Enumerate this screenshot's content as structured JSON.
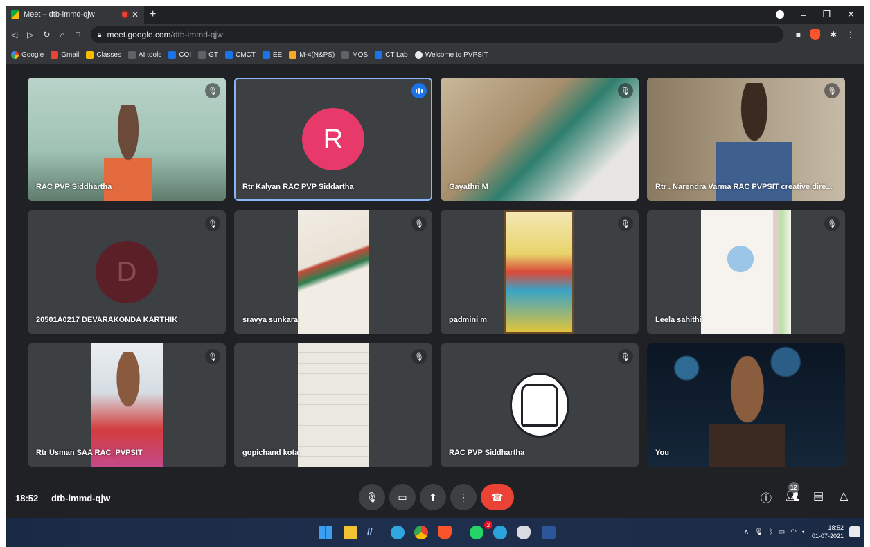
{
  "browser": {
    "tab_title": "Meet – dtb-immd-qjw",
    "url_host": "meet.google.com",
    "url_path": "/dtb-immd-qjw",
    "bookmarks": [
      {
        "label": "Google",
        "icon": "google-icon"
      },
      {
        "label": "Gmail",
        "icon": "gmail-icon"
      },
      {
        "label": "Classes",
        "icon": "classroom-icon"
      },
      {
        "label": "AI tools",
        "icon": "folder-icon"
      },
      {
        "label": "COI",
        "icon": "classroom-icon"
      },
      {
        "label": "GT",
        "icon": "folder-icon"
      },
      {
        "label": "CMCT",
        "icon": "classroom-icon"
      },
      {
        "label": "EE",
        "icon": "classroom-icon"
      },
      {
        "label": "M-4(N&PS)",
        "icon": "classroom-icon"
      },
      {
        "label": "MOS",
        "icon": "folder-icon"
      },
      {
        "label": "CT Lab",
        "icon": "classroom-icon"
      },
      {
        "label": "Welcome to PVPSIT",
        "icon": "globe-icon"
      }
    ]
  },
  "participants": [
    {
      "name": "RAC PVP Siddhartha",
      "state": "video",
      "muted": true
    },
    {
      "name": "Rtr Kalyan RAC PVP Siddartha",
      "state": "avatar",
      "initial": "R",
      "avatar_color": "#e8396b",
      "speaking": true
    },
    {
      "name": "Gayathri M",
      "state": "video",
      "muted": true
    },
    {
      "name": "Rtr . Narendra Varma RAC PVPSIT creative dire...",
      "state": "video",
      "muted": true
    },
    {
      "name": "20501A0217 DEVARAKONDA KARTHIK",
      "state": "avatar",
      "initial": "D",
      "avatar_color": "#6d1a22",
      "muted": true
    },
    {
      "name": "sravya sunkara",
      "state": "video",
      "muted": true
    },
    {
      "name": "padmini m",
      "state": "video",
      "muted": true
    },
    {
      "name": "Leela sahithi",
      "state": "video",
      "muted": true
    },
    {
      "name": "Rtr Usman SAA RAC_PVPSIT",
      "state": "video",
      "muted": true
    },
    {
      "name": "gopichand kota",
      "state": "video",
      "muted": true
    },
    {
      "name": "RAC PVP Siddhartha",
      "state": "video",
      "muted": true
    },
    {
      "name": "You",
      "state": "video",
      "muted": false
    }
  ],
  "controls": {
    "time": "18:52",
    "meeting_code": "dtb-immd-qjw",
    "people_count": "12"
  },
  "taskbar": {
    "clock_time": "18:52",
    "clock_date": "01-07-2021",
    "whatsapp_badge": "2"
  },
  "colors": {
    "stage_bg": "#202124",
    "tile_bg": "#3c4043",
    "end_call": "#ea4335",
    "speaking": "#1a73e8"
  }
}
